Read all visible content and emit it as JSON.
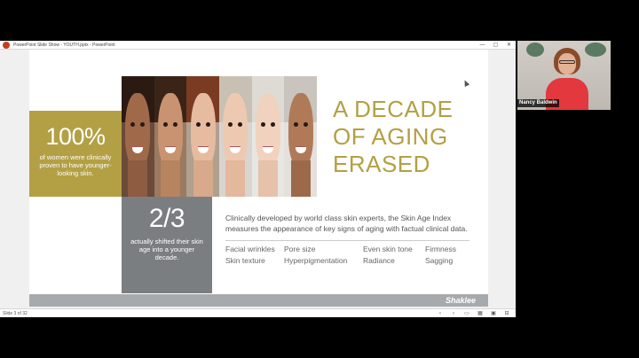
{
  "window": {
    "title": "PowerPoint Slide Show  -  YOUTH.pptx  -  PowerPoint",
    "controls": [
      "—",
      "▢",
      "✕"
    ]
  },
  "slide": {
    "stat1": {
      "value": "100%",
      "text": "of women were clinically proven to have younger-looking skin."
    },
    "stat2": {
      "value": "2/3",
      "text": "actually shifted their skin age into a younger decade."
    },
    "headline": [
      "A DECADE",
      "OF AGING",
      "ERASED"
    ],
    "description": "Clinically developed by world class skin experts, the Skin Age Index measures the appearance of key signs of aging with factual clinical data.",
    "signs": [
      "Facial wrinkles",
      "Pore size",
      "Even skin tone",
      "Firmness",
      "Skin texture",
      "Hyperpigmentation",
      "Radiance",
      "Sagging"
    ],
    "logo": "Shaklee"
  },
  "status": {
    "slide_count": "Slide 3 of 32",
    "controls": [
      "‹",
      "›",
      "▭",
      "▦",
      "▣",
      "⊟"
    ]
  },
  "webcam": {
    "name": "Nancy Baldwin"
  },
  "colors": {
    "gold": "#b3a044",
    "gray": "#7b7e80",
    "footer": "#a7aaac"
  }
}
